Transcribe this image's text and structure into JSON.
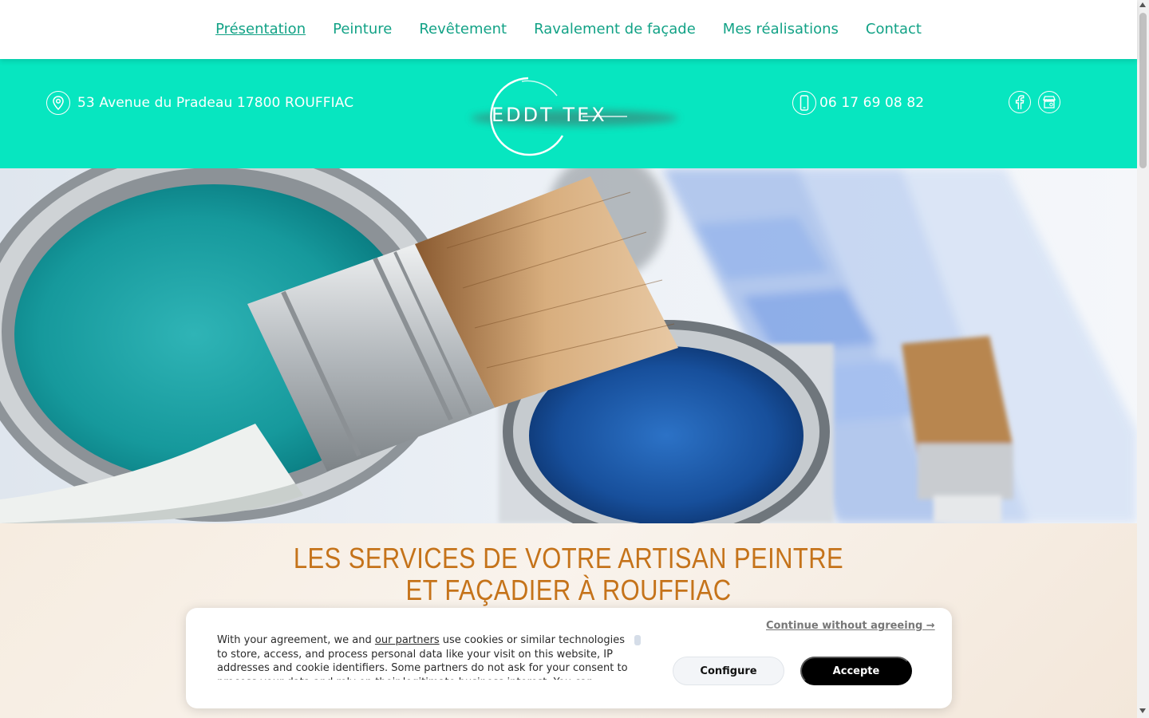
{
  "nav": {
    "items": [
      {
        "label": "Présentation"
      },
      {
        "label": "Peinture"
      },
      {
        "label": "Revêtement"
      },
      {
        "label": "Ravalement de façade"
      },
      {
        "label": "Mes réalisations"
      },
      {
        "label": "Contact"
      }
    ],
    "active_index": 0
  },
  "banner": {
    "address": "53 Avenue du Pradeau 17800 ROUFFIAC",
    "address_icon": "map-pin-icon",
    "logo_text": "EDDT TEX",
    "phone": "06 17 69 08 82",
    "phone_icon": "smartphone-icon",
    "social_icons": [
      "facebook-icon",
      "google-my-business-icon"
    ]
  },
  "hero": {
    "image": "paint-brush-and-paint-cans-photo"
  },
  "services": {
    "title": "LES SERVICES DE VOTRE ARTISAN PEINTRE ET FAÇADIER À ROUFFIAC"
  },
  "cookie": {
    "text_before": "With your agreement, we and ",
    "partners_link": "our partners",
    "text_after": " use cookies or similar technologies to store, access, and process personal data like your visit on this website, IP addresses and cookie identifiers. Some partners do not ask for your consent to process your data and rely on their legitimate business interest. You can",
    "continue_label": "Continue without agreeing →",
    "configure_label": "Configure",
    "accept_label": "Accepte"
  },
  "colors": {
    "accent": "#07e6c0",
    "nav_text": "#12a286",
    "title": "#c5731a"
  }
}
